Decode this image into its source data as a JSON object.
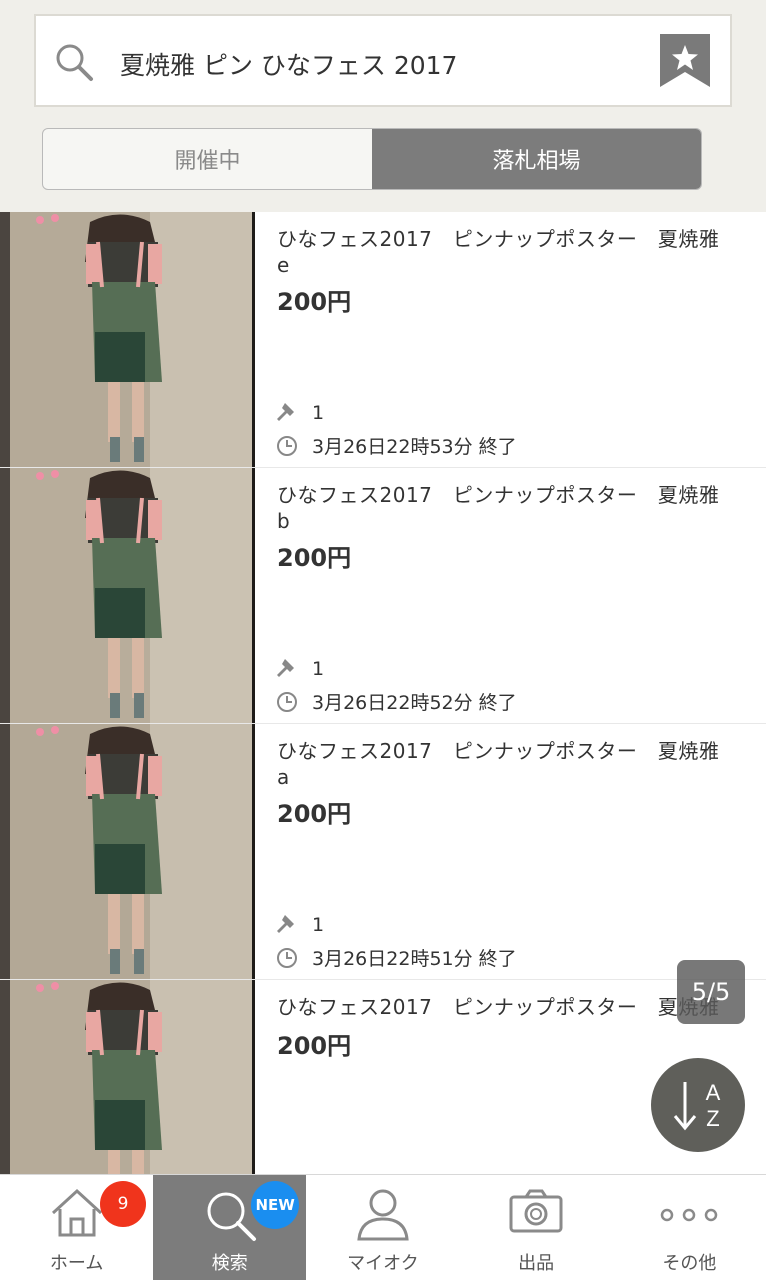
{
  "search": {
    "query": "夏焼雅 ピン ひなフェス 2017"
  },
  "segments": {
    "ongoing_label": "開催中",
    "closed_label": "落札相場"
  },
  "items": [
    {
      "title": "ひなフェス2017　ピンナップポスター　夏焼雅　e",
      "price": "200円",
      "bids": "1",
      "ended": "3月26日22時53分 終了"
    },
    {
      "title": "ひなフェス2017　ピンナップポスター　夏焼雅　b",
      "price": "200円",
      "bids": "1",
      "ended": "3月26日22時52分 終了"
    },
    {
      "title": "ひなフェス2017　ピンナップポスター　夏焼雅　a",
      "price": "200円",
      "bids": "1",
      "ended": "3月26日22時51分 終了"
    },
    {
      "title": "ひなフェス2017　ピンナップポスター　夏焼雅",
      "price": "200円"
    }
  ],
  "page_indicator": "5/5",
  "sort_button": {
    "top": "A",
    "bottom": "Z"
  },
  "tabbar": {
    "home": {
      "label": "ホーム",
      "badge": "9"
    },
    "search": {
      "label": "検索",
      "badge": "NEW"
    },
    "myauc": {
      "label": "マイオク"
    },
    "sell": {
      "label": "出品"
    },
    "more": {
      "label": "その他"
    }
  },
  "icons": {
    "search": "search-icon",
    "bookmark": "bookmark-star-icon",
    "gavel": "gavel-icon",
    "clock": "clock-icon",
    "sort": "sort-az-icon",
    "home": "home-icon",
    "search_tab": "magnifier-icon",
    "user": "user-icon",
    "camera": "camera-icon",
    "more": "more-dots-icon"
  },
  "colors": {
    "header_bg": "#f0efea",
    "segment_active": "#7c7c7c",
    "badge_red": "#f0341c",
    "badge_blue": "#1a8ef0"
  }
}
